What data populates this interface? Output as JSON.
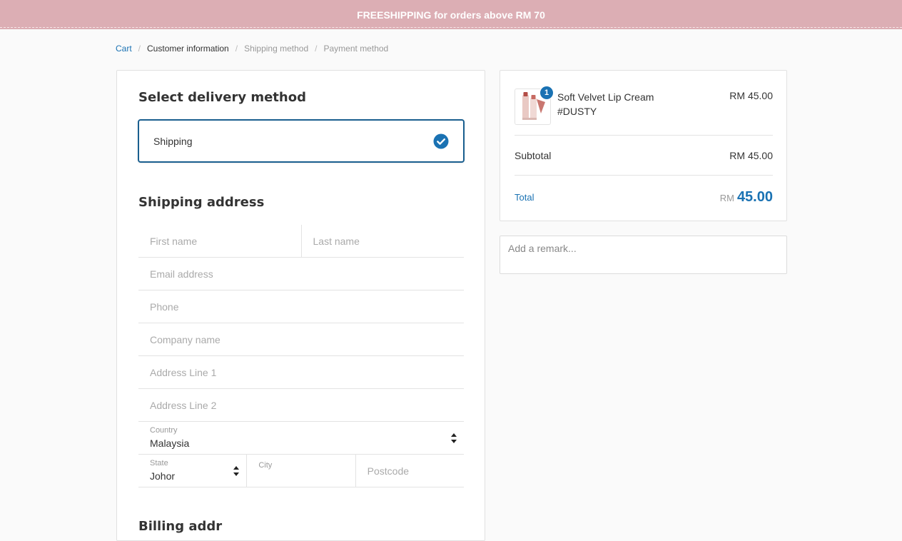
{
  "banner": {
    "text": "FREESHIPPING for orders above RM 70"
  },
  "breadcrumb": {
    "items": [
      "Cart",
      "Customer information",
      "Shipping method",
      "Payment method"
    ],
    "separator": "/"
  },
  "delivery": {
    "title": "Select delivery method",
    "option_label": "Shipping"
  },
  "shipping_address": {
    "title": "Shipping address",
    "first_name_placeholder": "First name",
    "last_name_placeholder": "Last name",
    "email_placeholder": "Email address",
    "phone_placeholder": "Phone",
    "company_placeholder": "Company name",
    "address1_placeholder": "Address Line 1",
    "address2_placeholder": "Address Line 2",
    "country_label": "Country",
    "country_value": "Malaysia",
    "state_label": "State",
    "state_value": "Johor",
    "city_label": "City",
    "postcode_placeholder": "Postcode"
  },
  "billing": {
    "title_visible": "Billing addr"
  },
  "summary": {
    "product": {
      "name_line1": "Soft Velvet Lip Cream",
      "name_line2": "#DUSTY",
      "price": "RM 45.00",
      "quantity": "1"
    },
    "subtotal_label": "Subtotal",
    "subtotal_value": "RM 45.00",
    "total_label": "Total",
    "total_currency": "RM",
    "total_value": "45.00"
  },
  "remark": {
    "placeholder": "Add a remark..."
  },
  "colors": {
    "banner": "#dcaeb4",
    "accent": "#1a72b3",
    "selected_border": "#1a5f8f"
  }
}
